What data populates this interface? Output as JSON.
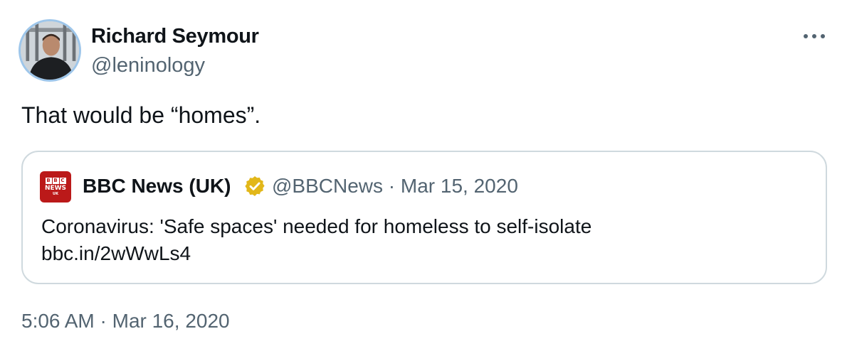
{
  "author": {
    "name": "Richard Seymour",
    "handle": "@leninology"
  },
  "tweet": {
    "text": "That would be “homes”.",
    "timestamp": "5:06 AM · Mar 16, 2020"
  },
  "quoted": {
    "logo": {
      "blocks": [
        "B",
        "B",
        "C"
      ],
      "wordmark": "NEWS",
      "sub": "UK"
    },
    "name": "BBC News (UK)",
    "meta": "@BBCNews · Mar 15, 2020",
    "text": "Coronavirus: 'Safe spaces' needed for homeless to self-isolate",
    "link": "bbc.in/2wWwLs4"
  },
  "icons": {
    "more": "more-horizontal-icon",
    "verified": "gold-verified-badge-icon"
  },
  "colors": {
    "text_primary": "#0f1419",
    "text_secondary": "#536471",
    "border": "#cfd9de",
    "verified_gold": "#e2b719",
    "bbc_red": "#bb1919"
  }
}
